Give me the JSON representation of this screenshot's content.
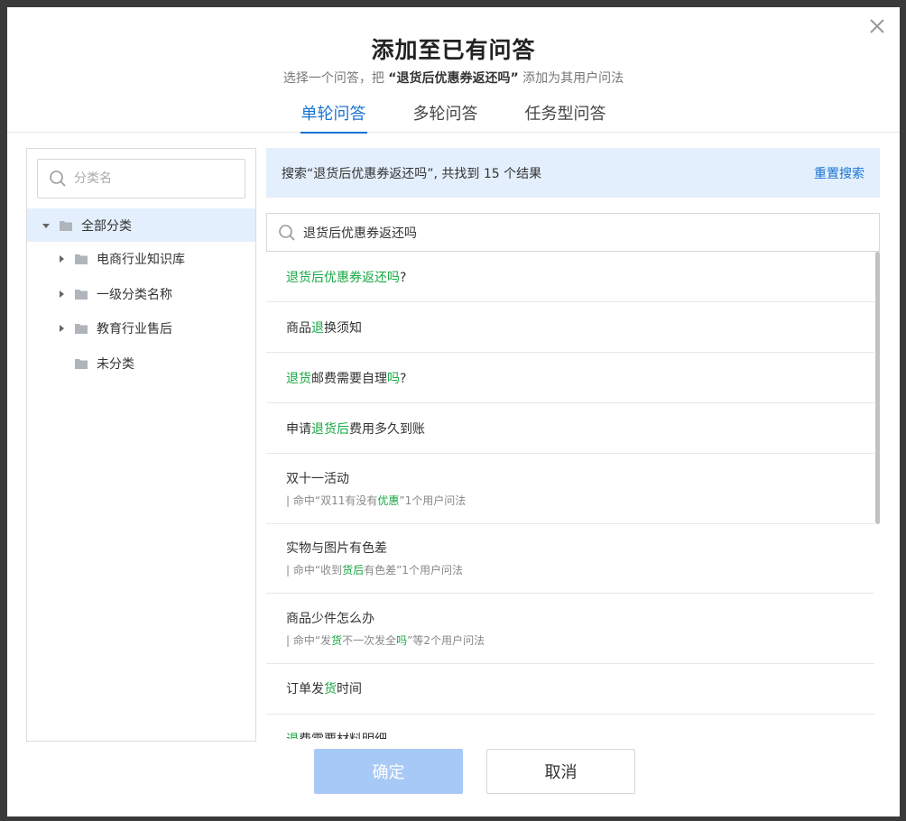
{
  "dialog": {
    "title": "添加至已有问答",
    "subtitle_prefix": "选择一个问答，把",
    "subtitle_question": "“退货后优惠券返还吗”",
    "subtitle_suffix": "添加为其用户问法"
  },
  "tabs": [
    {
      "label": "单轮问答",
      "active": true
    },
    {
      "label": "多轮问答",
      "active": false
    },
    {
      "label": "任务型问答",
      "active": false
    }
  ],
  "category_panel": {
    "search_placeholder": "分类名",
    "tree": [
      {
        "label": "全部分类",
        "level": 0,
        "expanded": true,
        "selected": true
      },
      {
        "label": "电商行业知识库",
        "level": 1,
        "has_children": true
      },
      {
        "label": "一级分类名称",
        "level": 1,
        "has_children": true
      },
      {
        "label": "教育行业售后",
        "level": 1,
        "has_children": true
      },
      {
        "label": "未分类",
        "level": 1,
        "has_children": false
      }
    ]
  },
  "results": {
    "banner_text": "搜索“退货后优惠券返还吗”, 共找到 15 个结果",
    "reset_label": "重置搜索",
    "search_value": "退货后优惠券返还吗",
    "items": [
      {
        "segments": [
          {
            "t": "退货后优惠券返还吗",
            "hl": true
          },
          {
            "t": "?",
            "hl": false
          }
        ]
      },
      {
        "segments": [
          {
            "t": "商品",
            "hl": false
          },
          {
            "t": "退",
            "hl": true
          },
          {
            "t": "换须知",
            "hl": false
          }
        ]
      },
      {
        "segments": [
          {
            "t": "退货",
            "hl": true
          },
          {
            "t": "邮费需要自理",
            "hl": false
          },
          {
            "t": "吗",
            "hl": true
          },
          {
            "t": "?",
            "hl": false
          }
        ]
      },
      {
        "segments": [
          {
            "t": "申请",
            "hl": false
          },
          {
            "t": "退货后",
            "hl": true
          },
          {
            "t": "费用多久到账",
            "hl": false
          }
        ]
      },
      {
        "segments": [
          {
            "t": "双十一活动",
            "hl": false
          }
        ],
        "sub": [
          {
            "t": "| 命中“双11有没有",
            "hl": false
          },
          {
            "t": "优惠",
            "hl": true
          },
          {
            "t": "”1个用户问法",
            "hl": false
          }
        ]
      },
      {
        "segments": [
          {
            "t": "实物与图片有色差",
            "hl": false
          }
        ],
        "sub": [
          {
            "t": "| 命中“收到",
            "hl": false
          },
          {
            "t": "货后",
            "hl": true
          },
          {
            "t": "有色差”1个用户问法",
            "hl": false
          }
        ]
      },
      {
        "segments": [
          {
            "t": "商品少件怎么办",
            "hl": false
          }
        ],
        "sub": [
          {
            "t": "| 命中“发",
            "hl": false
          },
          {
            "t": "货",
            "hl": true
          },
          {
            "t": "不一次发全",
            "hl": false
          },
          {
            "t": "吗",
            "hl": true
          },
          {
            "t": "”等2个用户问法",
            "hl": false
          }
        ]
      },
      {
        "segments": [
          {
            "t": "订单发",
            "hl": false
          },
          {
            "t": "货",
            "hl": true
          },
          {
            "t": "时间",
            "hl": false
          }
        ]
      },
      {
        "segments": [
          {
            "t": "退",
            "hl": true
          },
          {
            "t": "费需要材料明细",
            "hl": false
          }
        ]
      }
    ]
  },
  "footer": {
    "confirm_label": "确定",
    "cancel_label": "取消"
  },
  "colors": {
    "primary": "#1a74d2",
    "highlight": "#17a843",
    "selected_bg": "#e3effc",
    "confirm_disabled": "#a7c9f5"
  }
}
